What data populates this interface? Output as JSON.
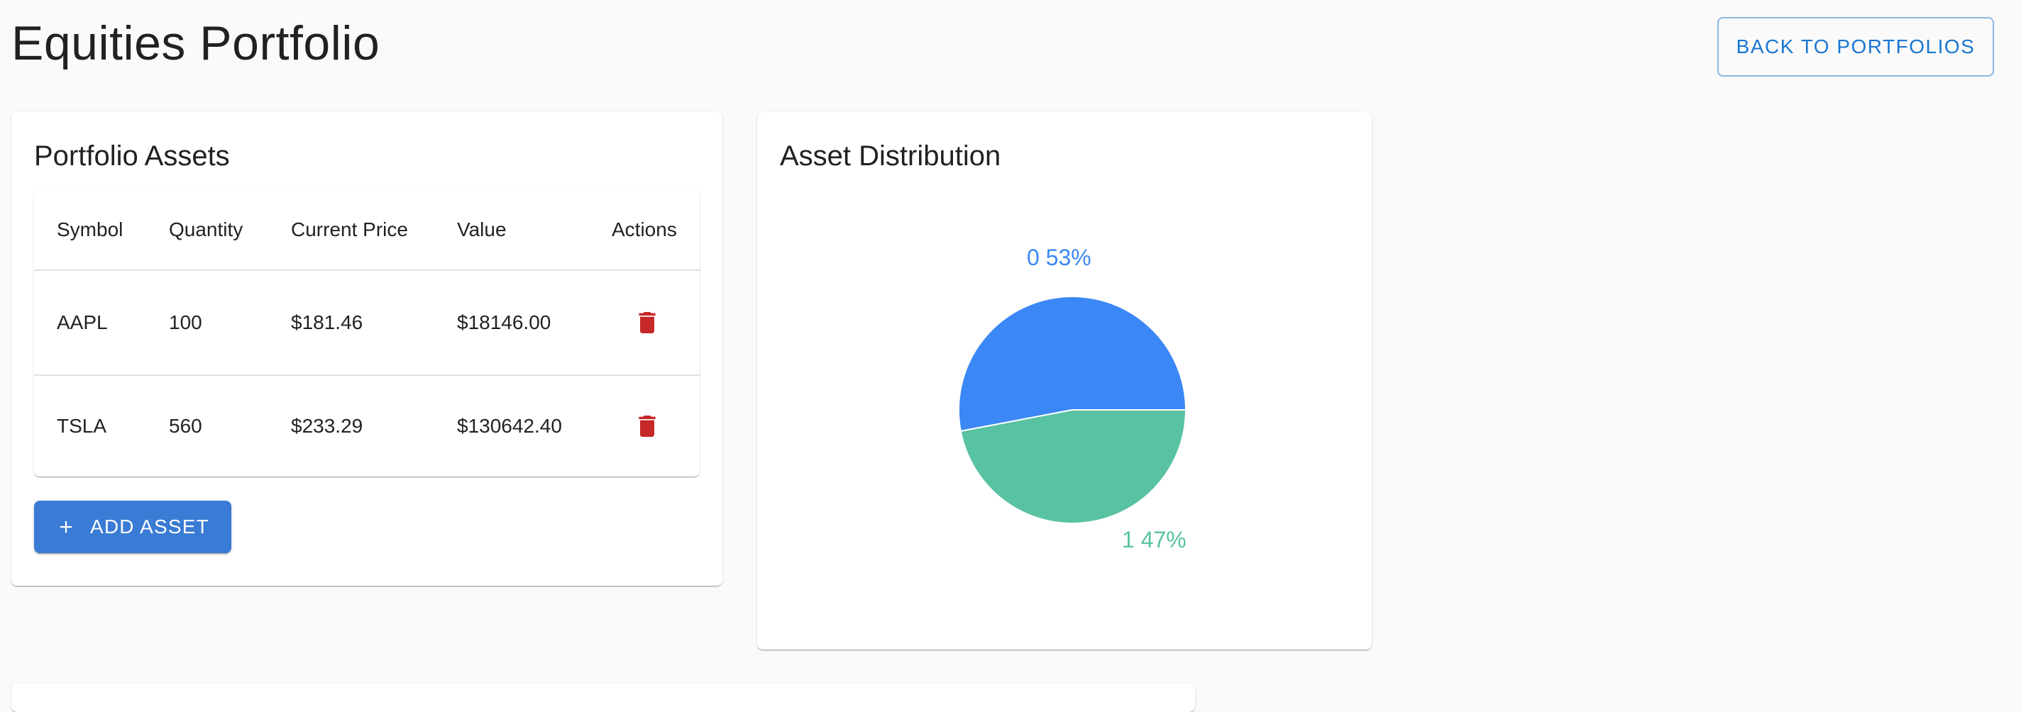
{
  "page": {
    "title": "Equities Portfolio",
    "back_label": "BACK TO PORTFOLIOS"
  },
  "assets": {
    "title": "Portfolio Assets",
    "columns": [
      "Symbol",
      "Quantity",
      "Current Price",
      "Value",
      "Actions"
    ],
    "rows": [
      {
        "symbol": "AAPL",
        "quantity": "100",
        "price": "$181.46",
        "value": "$18146.00",
        "action_icon": "trash-icon"
      },
      {
        "symbol": "TSLA",
        "quantity": "560",
        "price": "$233.29",
        "value": "$130642.40",
        "action_icon": "trash-icon"
      }
    ],
    "add_label": "ADD ASSET",
    "add_icon": "plus-icon"
  },
  "distribution": {
    "title": "Asset Distribution"
  },
  "chart_data": {
    "type": "pie",
    "title": "Asset Distribution",
    "slices": [
      {
        "label": "0 53%",
        "name": "0",
        "value": 53,
        "color": "#3b87f5"
      },
      {
        "label": "1 47%",
        "name": "1",
        "value": 47,
        "color": "#58c2a2"
      }
    ]
  },
  "colors": {
    "primary": "#1976d2",
    "add_button": "#3a7bd5",
    "delete": "#c62828"
  }
}
